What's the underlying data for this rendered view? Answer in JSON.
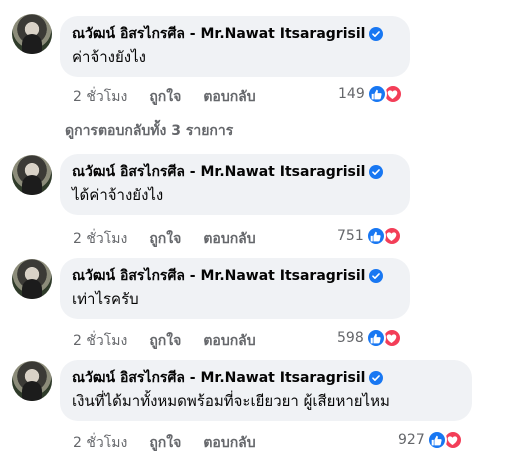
{
  "view_replies_label": "ดูการตอบกลับทั้ง 3 รายการ",
  "colors": {
    "like_blue": "#1877f2",
    "love_red": "#f33e58",
    "bubble_bg": "#f0f2f5",
    "meta_gray": "#65676b"
  },
  "comments": [
    {
      "author": "ณวัฒน์ อิสรไกรศีล - Mr.Nawat Itsaragrisil",
      "verified": true,
      "text": "ค่าจ้างยังไง",
      "time": "2 ชั่วโมง",
      "like_label": "ถูกใจ",
      "reply_label": "ตอบกลับ",
      "reaction_count": "149"
    },
    {
      "author": "ณวัฒน์ อิสรไกรศีล - Mr.Nawat Itsaragrisil",
      "verified": true,
      "text": "ได้ค่าจ้างยังไง",
      "time": "2 ชั่วโมง",
      "like_label": "ถูกใจ",
      "reply_label": "ตอบกลับ",
      "reaction_count": "751"
    },
    {
      "author": "ณวัฒน์ อิสรไกรศีล - Mr.Nawat Itsaragrisil",
      "verified": true,
      "text": "เท่าไรครับ",
      "time": "2 ชั่วโมง",
      "like_label": "ถูกใจ",
      "reply_label": "ตอบกลับ",
      "reaction_count": "598"
    },
    {
      "author": "ณวัฒน์ อิสรไกรศีล - Mr.Nawat Itsaragrisil",
      "verified": true,
      "text": "เงินที่ได้มาทั้งหมดพร้อมที่จะเยียวยา ผู้เสียหายไหม",
      "time": "2 ชั่วโมง",
      "like_label": "ถูกใจ",
      "reply_label": "ตอบกลับ",
      "reaction_count": "927"
    }
  ]
}
